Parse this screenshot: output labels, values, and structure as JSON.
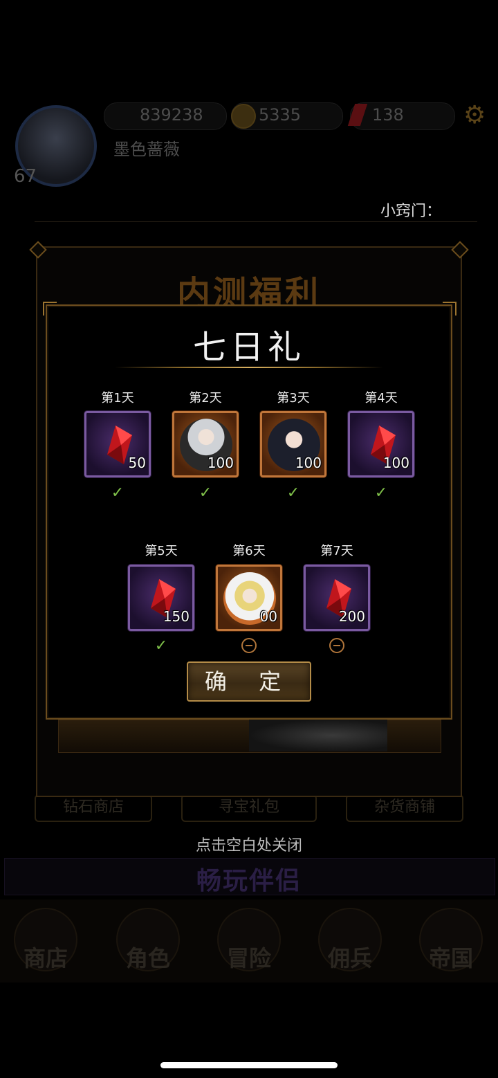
{
  "header": {
    "player_level": "67",
    "player_name": "墨色蔷薇",
    "gold": "839238",
    "coins": "5335",
    "gems": "138",
    "small_gate_label": "小窍门："
  },
  "outer_dialog": {
    "title": "内测福利"
  },
  "dialog": {
    "title": "七日礼",
    "confirm_label": "确 定",
    "rewards_row1": [
      {
        "day": "第1天",
        "count": "50",
        "type": "gem",
        "status": "claimed"
      },
      {
        "day": "第2天",
        "count": "100",
        "type": "hero",
        "status": "claimed"
      },
      {
        "day": "第3天",
        "count": "100",
        "type": "hero",
        "status": "claimed"
      },
      {
        "day": "第4天",
        "count": "100",
        "type": "gem",
        "status": "claimed"
      }
    ],
    "rewards_row2": [
      {
        "day": "第5天",
        "count": "150",
        "type": "gem",
        "status": "claimed"
      },
      {
        "day": "第6天",
        "count": "00",
        "type": "hero",
        "status": "pending"
      },
      {
        "day": "第7天",
        "count": "200",
        "type": "gem",
        "status": "pending"
      }
    ]
  },
  "background_tabs": [
    "钻石商店",
    "寻宝礼包",
    "杂货商铺"
  ],
  "close_hint": "点击空白处关闭",
  "banner_text": "畅玩伴侣",
  "nav": [
    "商店",
    "角色",
    "冒险",
    "佣兵",
    "帝国"
  ],
  "colors": {
    "gold_border": "#b48c48",
    "gem_tile": "#7a5aa0",
    "hero_tile": "#c0763a",
    "check": "#7fc04a"
  }
}
